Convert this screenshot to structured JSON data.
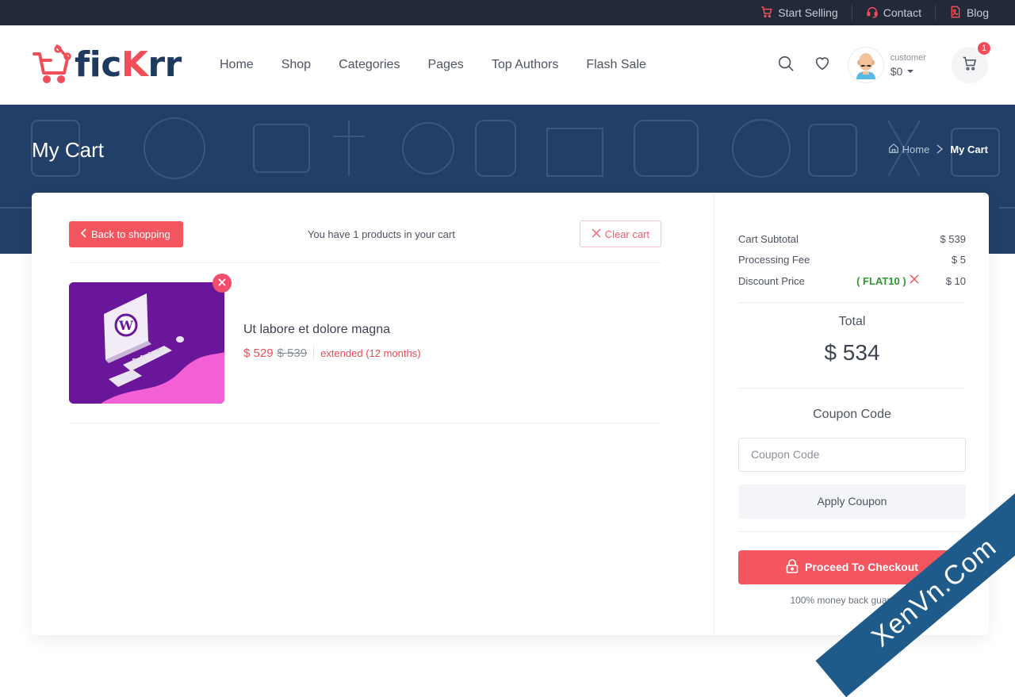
{
  "topbar": {
    "links": [
      {
        "label": "Start Selling",
        "icon": "cart-icon"
      },
      {
        "label": "Contact",
        "icon": "headset-icon"
      },
      {
        "label": "Blog",
        "icon": "document-icon"
      }
    ]
  },
  "header": {
    "logo": {
      "prefix": "fic",
      "accent": "K",
      "suffix": "rr"
    },
    "nav": [
      "Home",
      "Shop",
      "Categories",
      "Pages",
      "Top Authors",
      "Flash Sale"
    ],
    "user": {
      "role": "customer",
      "balance": "$0"
    },
    "cart_count": "1"
  },
  "hero": {
    "title": "My Cart",
    "breadcrumb": {
      "home": "Home",
      "current": "My Cart"
    }
  },
  "cart": {
    "back_label": "Back to shopping",
    "count_text": "You have 1 products in your cart",
    "clear_label": "Clear cart",
    "items": [
      {
        "title": "Ut labore et dolore magna",
        "price": "$ 529",
        "old_price": "$ 539",
        "license": "extended (12 months)"
      }
    ]
  },
  "summary": {
    "subtotal_label": "Cart Subtotal",
    "subtotal_value": "$ 539",
    "fee_label": "Processing Fee",
    "fee_value": "$ 5",
    "discount_label": "Discount Price",
    "discount_code": "( FLAT10 )",
    "discount_value": "$ 10",
    "total_label": "Total",
    "total_value": "$ 534",
    "coupon_title": "Coupon Code",
    "coupon_placeholder": "Coupon Code",
    "coupon_value": "",
    "apply_label": "Apply Coupon",
    "checkout_label": "Proceed To Checkout",
    "guarantee": "100% money back guarantee"
  },
  "watermark": "XenVn.Com",
  "colors": {
    "accent": "#f4565f",
    "navy": "#213f67",
    "topbar": "#222a3a",
    "coupon_green": "#2e9a2e"
  }
}
